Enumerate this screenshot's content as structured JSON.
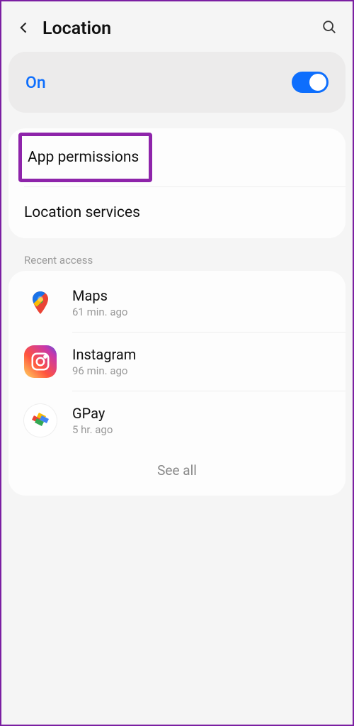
{
  "header": {
    "title": "Location"
  },
  "toggle": {
    "label": "On",
    "state": true
  },
  "links": {
    "app_permissions": "App permissions",
    "location_services": "Location services"
  },
  "recent": {
    "section_label": "Recent access",
    "items": [
      {
        "name": "Maps",
        "time": "61 min. ago",
        "icon": "maps-icon"
      },
      {
        "name": "Instagram",
        "time": "96 min. ago",
        "icon": "instagram-icon"
      },
      {
        "name": "GPay",
        "time": "5 hr. ago",
        "icon": "gpay-icon"
      }
    ],
    "see_all": "See all"
  },
  "highlight": "app_permissions"
}
